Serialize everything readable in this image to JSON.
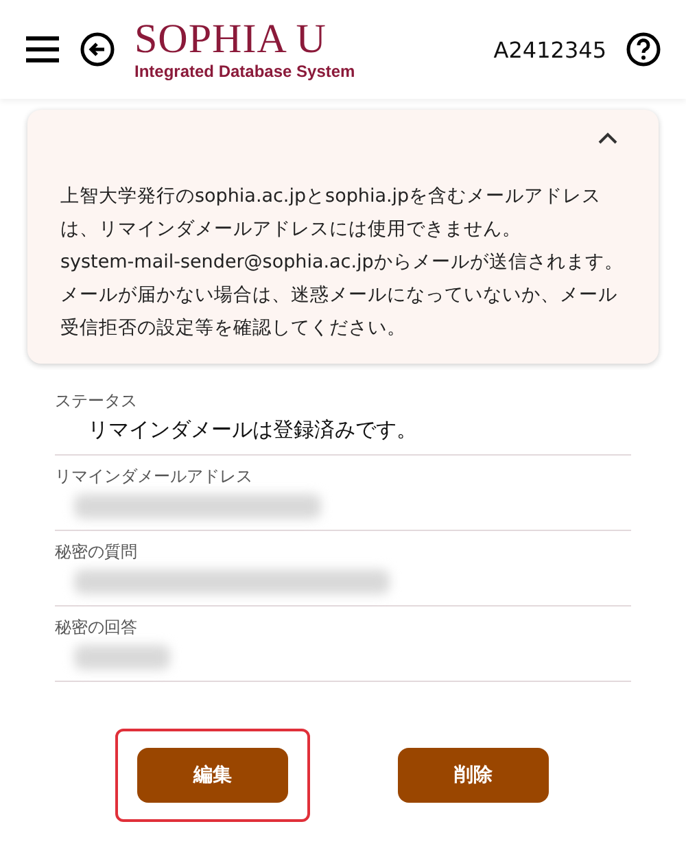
{
  "header": {
    "logo_title": "SOPHIA U",
    "logo_subtitle": "Integrated Database System",
    "user_id": "A2412345"
  },
  "notice": {
    "expanded": true,
    "paragraphs": [
      "上智大学発行のsophia.ac.jpとsophia.jpを含むメールアドレスは、リマインダメールアドレスには使用できません。",
      "system-mail-sender@sophia.ac.jpからメールが送信されます。",
      "メールが届かない場合は、迷惑メールになっていないか、メール受信拒否の設定等を確認してください。"
    ]
  },
  "fields": [
    {
      "label": "ステータス",
      "kind": "text",
      "value": "リマインダメールは登録済みです。"
    },
    {
      "label": "リマインダメールアドレス",
      "kind": "redacted"
    },
    {
      "label": "秘密の質問",
      "kind": "redacted"
    },
    {
      "label": "秘密の回答",
      "kind": "redacted"
    }
  ],
  "buttons": [
    {
      "label": "編集",
      "highlighted": true
    },
    {
      "label": "削除",
      "highlighted": false
    }
  ]
}
